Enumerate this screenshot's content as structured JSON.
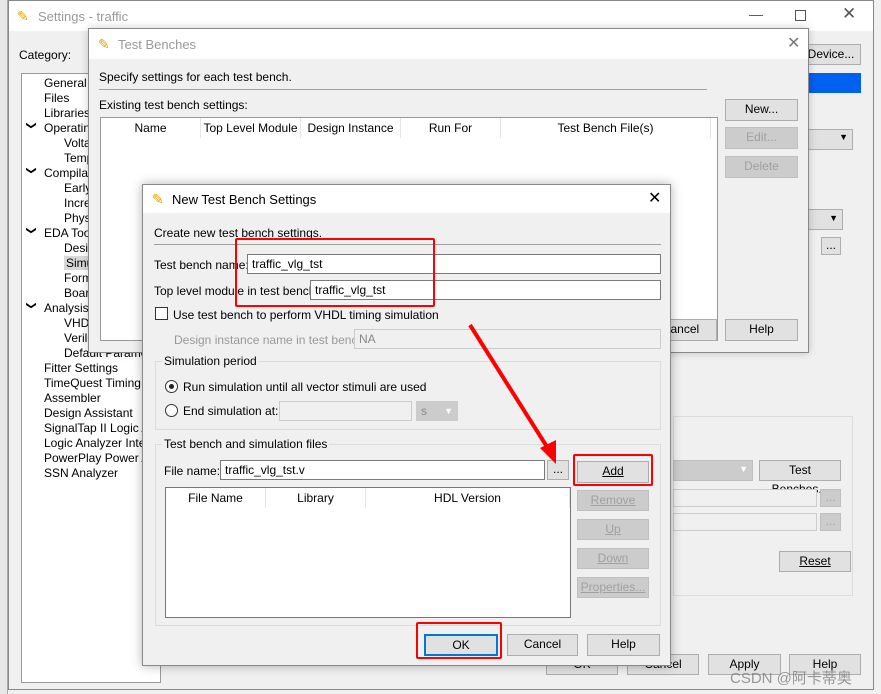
{
  "settings": {
    "title": "Settings - traffic",
    "category_label": "Category:",
    "device_button": "Device...",
    "tree": [
      {
        "label": "General",
        "level": 0
      },
      {
        "label": "Files",
        "level": 0
      },
      {
        "label": "Libraries",
        "level": 0
      },
      {
        "label": "Operating",
        "level": 0,
        "expanded": true
      },
      {
        "label": "Volta",
        "level": 1
      },
      {
        "label": "Temp",
        "level": 1
      },
      {
        "label": "Compilatio",
        "level": 0,
        "expanded": true
      },
      {
        "label": "Early",
        "level": 1
      },
      {
        "label": "Incre",
        "level": 1
      },
      {
        "label": "Physi",
        "level": 1
      },
      {
        "label": "EDA Tool",
        "level": 0,
        "expanded": true
      },
      {
        "label": "Desig",
        "level": 1
      },
      {
        "label": "Simul",
        "level": 1,
        "selected": true
      },
      {
        "label": "Form",
        "level": 1
      },
      {
        "label": "Boar",
        "level": 1
      },
      {
        "label": "Analysis &",
        "level": 0,
        "expanded": true
      },
      {
        "label": "VHDL",
        "level": 1
      },
      {
        "label": "Verilo",
        "level": 1
      },
      {
        "label": "Default Paramete",
        "level": 1
      },
      {
        "label": "Fitter Settings",
        "level": 0
      },
      {
        "label": "TimeQuest Timing An",
        "level": 0
      },
      {
        "label": "Assembler",
        "level": 0
      },
      {
        "label": "Design Assistant",
        "level": 0
      },
      {
        "label": "SignalTap II Logic An",
        "level": 0
      },
      {
        "label": "Logic Analyzer Interf",
        "level": 0
      },
      {
        "label": "PowerPlay Power An",
        "level": 0
      },
      {
        "label": "SSN Analyzer",
        "level": 0
      }
    ],
    "test_benches_button": "Test Benches...",
    "browse": "...",
    "reset": "Reset",
    "ok": "OK",
    "cancel": "Cancel",
    "apply": "Apply",
    "help": "Help"
  },
  "test_benches": {
    "title": "Test Benches",
    "description": "Specify settings for each test bench.",
    "existing_label": "Existing test bench settings:",
    "columns": [
      "Name",
      "Top Level Module",
      "Design Instance",
      "Run For",
      "Test Bench File(s)"
    ],
    "new": "New...",
    "edit": "Edit...",
    "delete": "Delete",
    "cancel": "Cancel",
    "help": "Help"
  },
  "new_tb": {
    "title": "New Test Bench Settings",
    "description": "Create new test bench settings.",
    "tb_name_label": "Test bench name:",
    "tb_name": "traffic_vlg_tst",
    "top_label": "Top level module in test bench:",
    "top": "traffic_vlg_tst",
    "vhdl_timing_label": "Use test bench to perform VHDL timing simulation",
    "vhdl_timing_checked": false,
    "instance_label": "Design instance name in test bench:",
    "instance": "NA",
    "sim_period": {
      "legend": "Simulation period",
      "run_all": "Run simulation until all vector stimuli are used",
      "end_at": "End simulation at:",
      "selected": "run_all",
      "end_value": "",
      "unit": "s"
    },
    "files": {
      "legend": "Test bench and simulation files",
      "file_label": "File name:",
      "file": "traffic_vlg_tst.v",
      "browse": "...",
      "add": "Add",
      "remove": "Remove",
      "up": "Up",
      "down": "Down",
      "properties": "Properties...",
      "columns": [
        "File Name",
        "Library",
        "HDL Version"
      ]
    },
    "ok": "OK",
    "cancel": "Cancel",
    "help": "Help"
  },
  "annotation_color": "#ff0000",
  "watermark": "CSDN @阿卡蒂奥"
}
